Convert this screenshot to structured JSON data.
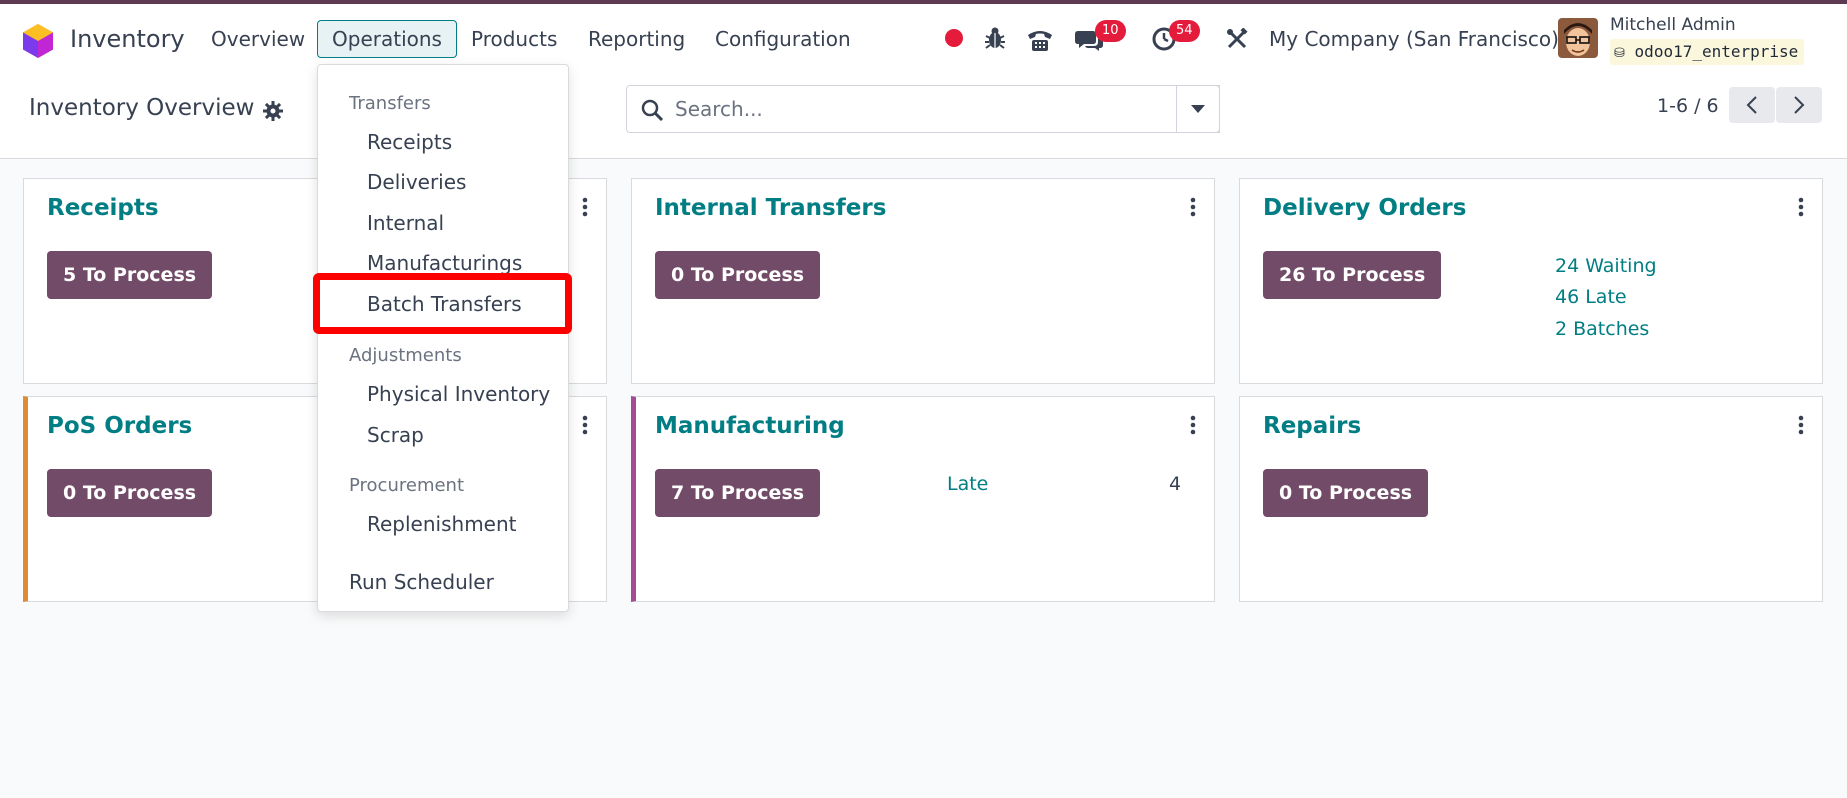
{
  "navbar": {
    "app_name": "Inventory",
    "menus": [
      "Overview",
      "Operations",
      "Products",
      "Reporting",
      "Configuration"
    ],
    "active_menu": "Operations",
    "messages_badge": "10",
    "activities_badge": "54",
    "company": "My Company (San Francisco)",
    "user_name": "Mitchell Admin",
    "database": "odoo17_enterprise",
    "icons": [
      "record-icon",
      "bug-icon",
      "phone-icon",
      "chat-icon",
      "clock-icon",
      "tools-icon"
    ],
    "colors": {
      "brand": "#714b67",
      "accent": "#017e84",
      "badge": "#e41b3a",
      "record": "#e41b3a"
    }
  },
  "control_panel": {
    "title": "Inventory Overview",
    "search_placeholder": "Search...",
    "pager": "1-6 / 6"
  },
  "dropdown": {
    "sections": [
      {
        "header": "Transfers",
        "items": [
          "Receipts",
          "Deliveries",
          "Internal",
          "Manufacturings",
          "Batch Transfers"
        ]
      },
      {
        "header": "Adjustments",
        "items": [
          "Physical Inventory",
          "Scrap"
        ]
      },
      {
        "header": "Procurement",
        "items": [
          "Replenishment"
        ]
      }
    ],
    "footer_item": "Run Scheduler",
    "highlighted_item": "Batch Transfers",
    "highlight_color": "#ff0000"
  },
  "cards": [
    {
      "title": "Receipts",
      "button": "5 To Process"
    },
    {
      "title": "Internal Transfers",
      "button": "0 To Process"
    },
    {
      "title": "Delivery Orders",
      "button": "26 To Process",
      "stats": [
        "24 Waiting",
        "46 Late",
        "2 Batches"
      ]
    },
    {
      "title": "PoS Orders",
      "button": "0 To Process",
      "accent": "#e08a31"
    },
    {
      "title": "Manufacturing",
      "button": "7 To Process",
      "late_label": "Late",
      "late_value": "4",
      "accent": "#a54a94"
    },
    {
      "title": "Repairs",
      "button": "0 To Process"
    }
  ]
}
